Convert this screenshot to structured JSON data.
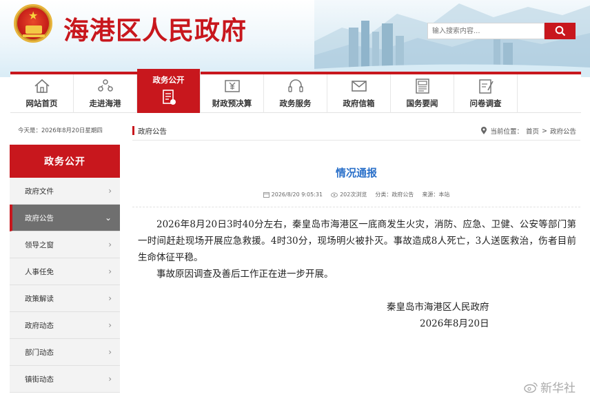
{
  "site": {
    "title": "海港区人民政府"
  },
  "search": {
    "placeholder": "输入搜索内容..."
  },
  "nav": {
    "items": [
      {
        "label": "网站首页",
        "icon": "home-icon"
      },
      {
        "label": "走进海港",
        "icon": "people-icon"
      },
      {
        "label": "政务公开",
        "icon": "document-icon",
        "active": true
      },
      {
        "label": "财政预决算",
        "icon": "finance-icon"
      },
      {
        "label": "政务服务",
        "icon": "headset-icon"
      },
      {
        "label": "政府信箱",
        "icon": "mail-icon"
      },
      {
        "label": "国务要闻",
        "icon": "newspaper-icon"
      },
      {
        "label": "问卷调查",
        "icon": "survey-icon"
      }
    ]
  },
  "date_line": "今天是：2026年8月20日星期四",
  "sidebar": {
    "heading": "政务公开",
    "items": [
      {
        "label": "政府文件"
      },
      {
        "label": "政府公告",
        "active": true
      },
      {
        "label": "领导之窗"
      },
      {
        "label": "人事任免"
      },
      {
        "label": "政策解读"
      },
      {
        "label": "政府动态"
      },
      {
        "label": "部门动态"
      },
      {
        "label": "镇街动态"
      }
    ]
  },
  "breadcrumb": {
    "section": "政府公告",
    "prefix": "当前位置：",
    "home": "首页",
    "sep": ">",
    "current": "政府公告"
  },
  "article": {
    "title": "情况通报",
    "meta": {
      "date": "2026/8/20 9:05:31",
      "views": "202次浏览",
      "category": "分类：政府公告",
      "source": "来源：本站"
    },
    "paragraphs": [
      "2026年8月20日3时40分左右，秦皇岛市海港区一底商发生火灾，消防、应急、卫健、公安等部门第一时间赶赴现场开展应急救援。4时30分，现场明火被扑灭。事故造成8人死亡，3人送医救治，伤者目前生命体征平稳。",
      "事故原因调查及善后工作正在进一步开展。"
    ],
    "signature": "秦皇岛市海港区人民政府",
    "sign_date": "2026年8月20日"
  },
  "watermark": "新华社",
  "colors": {
    "brand_red": "#c8171d",
    "title_blue": "#2a70c9"
  }
}
